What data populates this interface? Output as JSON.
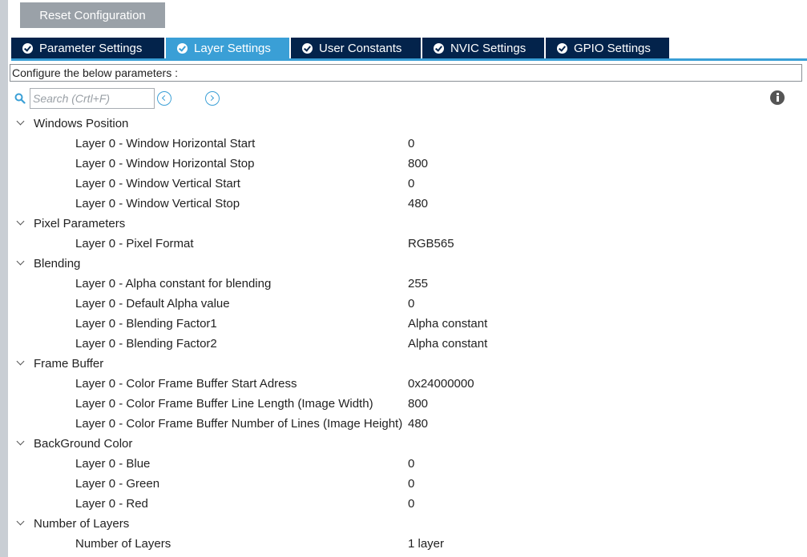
{
  "toolbar": {
    "reset_label": "Reset Configuration"
  },
  "tabs": [
    {
      "label": "Parameter Settings",
      "active": false
    },
    {
      "label": "Layer Settings",
      "active": true
    },
    {
      "label": "User Constants",
      "active": false
    },
    {
      "label": "NVIC Settings",
      "active": false
    },
    {
      "label": "GPIO Settings",
      "active": false
    }
  ],
  "config_bar": {
    "text": "Configure the below parameters :"
  },
  "search": {
    "placeholder": "Search (Crtl+F)",
    "value": ""
  },
  "icons": {
    "search": "search-icon",
    "prev": "circle-chevron-left-icon",
    "next": "circle-chevron-right-icon",
    "info": "info-icon",
    "tab_status": "check-circle-icon",
    "expand": "chevron-down-icon"
  },
  "colors": {
    "tab_bg": "#03234b",
    "tab_active_bg": "#3a9fd6",
    "reset_bg": "#9aa1a8",
    "accent": "#3a9fd6"
  },
  "groups": [
    {
      "label": "Windows Position",
      "expanded": true,
      "params": [
        {
          "label": "Layer 0 - Window Horizontal Start",
          "value": "0"
        },
        {
          "label": "Layer 0 - Window Horizontal Stop",
          "value": "800"
        },
        {
          "label": "Layer 0 - Window Vertical Start",
          "value": "0"
        },
        {
          "label": "Layer 0 - Window Vertical Stop",
          "value": "480"
        }
      ]
    },
    {
      "label": "Pixel Parameters",
      "expanded": true,
      "params": [
        {
          "label": "Layer 0 - Pixel Format",
          "value": "RGB565"
        }
      ]
    },
    {
      "label": "Blending",
      "expanded": true,
      "params": [
        {
          "label": "Layer 0 - Alpha constant for blending",
          "value": "255"
        },
        {
          "label": "Layer 0 - Default Alpha value",
          "value": "0"
        },
        {
          "label": "Layer 0 - Blending Factor1",
          "value": "Alpha constant"
        },
        {
          "label": "Layer 0 - Blending Factor2",
          "value": "Alpha constant"
        }
      ]
    },
    {
      "label": "Frame Buffer",
      "expanded": true,
      "params": [
        {
          "label": "Layer 0 - Color Frame Buffer Start Adress",
          "value": "0x24000000"
        },
        {
          "label": "Layer 0 - Color Frame Buffer Line Length (Image Width)",
          "value": "800"
        },
        {
          "label": "Layer 0 - Color Frame Buffer Number of Lines (Image Height)",
          "value": "480"
        }
      ]
    },
    {
      "label": "BackGround Color",
      "expanded": true,
      "params": [
        {
          "label": "Layer 0 - Blue",
          "value": "0"
        },
        {
          "label": "Layer 0 - Green",
          "value": "0"
        },
        {
          "label": "Layer 0 - Red",
          "value": "0"
        }
      ]
    },
    {
      "label": "Number of Layers",
      "expanded": true,
      "params": [
        {
          "label": "Number of Layers",
          "value": "1 layer"
        }
      ]
    }
  ]
}
